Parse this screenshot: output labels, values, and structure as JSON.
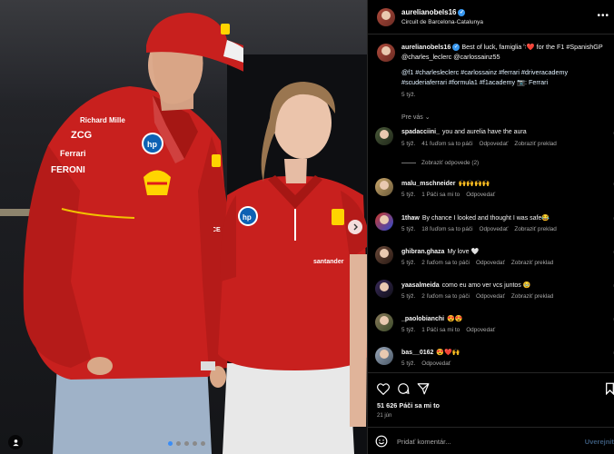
{
  "post": {
    "username": "aurelianobels16",
    "location": "Circuit de Barcelona-Catalunya",
    "more_icon": "more-horizontal-icon",
    "caption_text": "Best of luck, famiglia ꞌ꞉❤️ for the F1 #SpanishGP @charles_leclerc @carlossainz55",
    "caption_tags": "@f1 #charlesleclerc #carlossainz #ferrari #driveracademy #scuderiaferrari #formula1 #f1academy 📷: Ferrari",
    "caption_time": "5 týž.",
    "for_you_label": "Pre vás",
    "likes_label": "51 626 Páči sa mi to",
    "date_label": "21 jún",
    "add_comment_placeholder": "Pridať komentár...",
    "post_button_label": "Uverejniť"
  },
  "comments": [
    {
      "username": "spadacciini_",
      "text": "you and aurelia have the aura",
      "time": "5 týž.",
      "likes": "41 ľuďom sa to páči",
      "reply": "Odpovedať",
      "translate": "Zobraziť preklad",
      "replies_label": "Zobraziť odpovede (2)"
    },
    {
      "username": "malu_mschneider",
      "text": "🙌🙌🙌🙌",
      "time": "5 týž.",
      "likes": "1 Páči sa mi to",
      "reply": "Odpovedať",
      "translate": ""
    },
    {
      "username": "1thaw",
      "text": "By chance I looked and thought I was safe😂",
      "time": "5 týž.",
      "likes": "18 ľuďom sa to páči",
      "reply": "Odpovedať",
      "translate": "Zobraziť preklad"
    },
    {
      "username": "ghibran.ghaza",
      "text": "My love 🤍",
      "time": "5 týž.",
      "likes": "2 ľuďom sa to páči",
      "reply": "Odpovedať",
      "translate": "Zobraziť preklad"
    },
    {
      "username": "yaasalmeida",
      "text": "como eu amo ver vcs juntos 🥹",
      "time": "5 týž.",
      "likes": "2 ľuďom sa to páči",
      "reply": "Odpovedať",
      "translate": "Zobraziť preklad"
    },
    {
      "username": "_paolobianchi",
      "text": "😍😍",
      "time": "5 týž.",
      "likes": "1 Páči sa mi to",
      "reply": "Odpovedať",
      "translate": ""
    },
    {
      "username": "bas__0162",
      "text": "😍❤️🙌",
      "time": "5 týž.",
      "likes": "",
      "reply": "Odpovedať",
      "translate": ""
    }
  ],
  "colors": {
    "accent_blue": "#3797f0",
    "ferrari_red": "#c8201e",
    "muted_text": "#a8a8a8"
  },
  "photo_marks": {
    "shirt_1": "Richard Mille",
    "shirt_2": "ZCG",
    "shirt_3": "Ferrari",
    "shirt_4": "FERONI",
    "shirt_5": "santander",
    "shirt_6": "hp",
    "shirt_7": "CE"
  }
}
